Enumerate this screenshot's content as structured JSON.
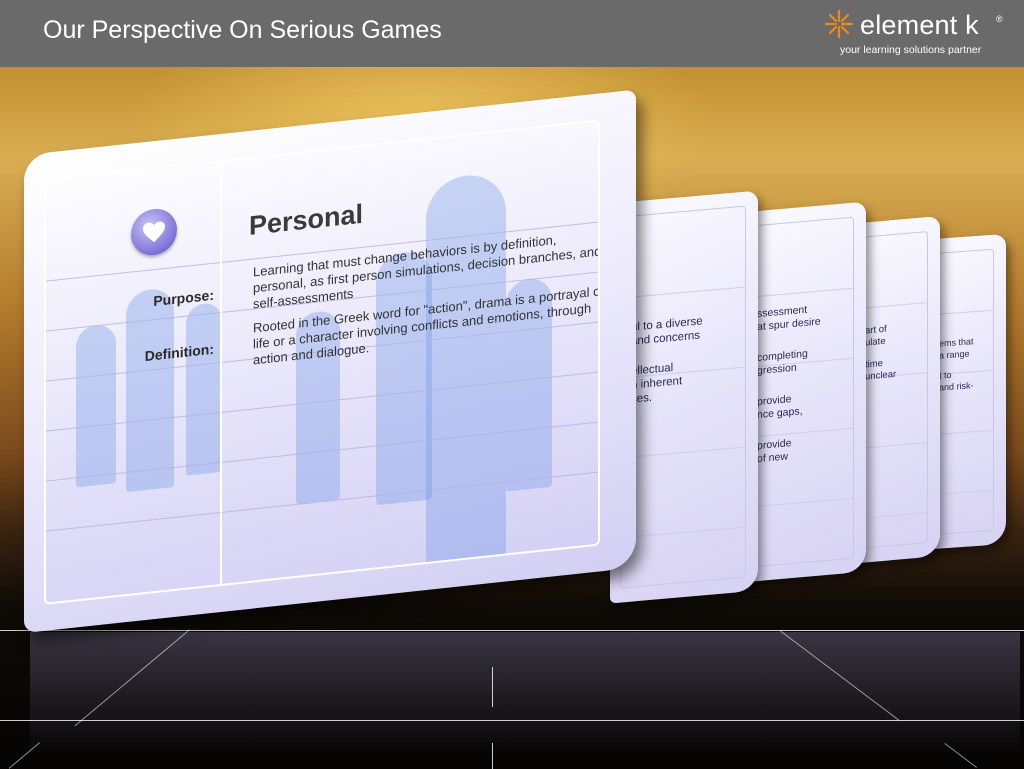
{
  "header": {
    "title": "Our Perspective On Serious Games"
  },
  "logo": {
    "name": "element k",
    "registered": "®",
    "tagline": "your learning solutions partner",
    "icon": "starburst-icon"
  },
  "front_card": {
    "icon": "heart-icon",
    "title": "Personal",
    "purpose_label": "Purpose:",
    "purpose_text": "Learning that must change behaviors is by definition, personal, as first person simulations, decision branches, and self-assessments",
    "definition_label": "Definition:",
    "definition_text": "Rooted in the Greek word for \"action\", drama is a portrayal of life or a character involving conflicts and emotions, through action and dialogue."
  },
  "back_cards": [
    {
      "lines": [
        "ul to a diverse",
        "and concerns",
        "",
        "ellectual",
        "n inherent",
        "ces."
      ]
    },
    {
      "lines": [
        "ssessment",
        "at spur desire",
        "",
        "completing",
        "gression",
        "",
        "provide",
        "nce gaps,",
        "",
        "provide",
        "of new"
      ]
    },
    {
      "lines": [
        "art of",
        "ulate",
        "",
        "time",
        "unclear"
      ]
    },
    {
      "lines": [
        "ems that",
        "a range",
        "",
        "t to",
        "and risk-"
      ]
    }
  ],
  "colors": {
    "header_bg": "#6a6a6a",
    "card_accent": "#7d72d6"
  }
}
